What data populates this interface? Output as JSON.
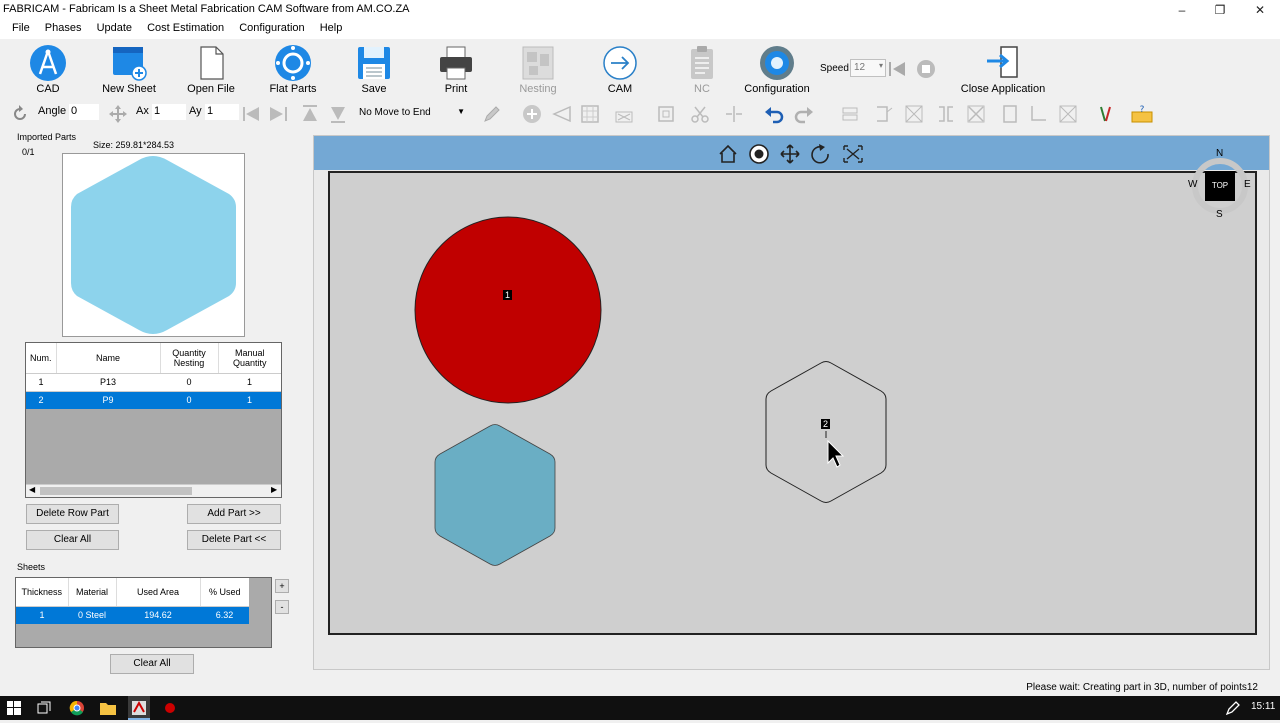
{
  "window": {
    "title": "FABRICAM - Fabricam Is a Sheet Metal Fabrication CAM Software from AM.CO.ZA"
  },
  "menu": [
    "File",
    "Phases",
    "Update",
    "Cost Estimation",
    "Configuration",
    "Help"
  ],
  "toolbar": {
    "cad": "CAD",
    "new_sheet": "New Sheet",
    "open_file": "Open File",
    "flat_parts": "Flat Parts",
    "save": "Save",
    "print": "Print",
    "nesting": "Nesting",
    "cam": "CAM",
    "nc": "NC",
    "configuration": "Configuration",
    "close_application": "Close Application",
    "speed_label": "Speed",
    "speed_value": "12"
  },
  "toolbar2": {
    "angle_label": "Angle",
    "angle_value": "0",
    "ax_label": "Ax",
    "ax_value": "1",
    "ay_label": "Ay",
    "ay_value": "1",
    "move_select": "No Move to End"
  },
  "imported": {
    "title": "Imported Parts",
    "count": "0/1",
    "size": "Size: 259.81*284.53"
  },
  "parts_table": {
    "headers": [
      "Num.",
      "Name",
      "Quantity Nesting",
      "Manual Quantity"
    ],
    "rows": [
      [
        "1",
        "P13",
        "0",
        "1"
      ],
      [
        "2",
        "P9",
        "0",
        "1"
      ]
    ],
    "selected": 1
  },
  "buttons": {
    "delete_row": "Delete Row Part",
    "add_part": "Add Part >>",
    "clear_all": "Clear All",
    "delete_part": "Delete Part <<",
    "clear_all2": "Clear All",
    "plus": "+",
    "minus": "-"
  },
  "sheets": {
    "title": "Sheets",
    "headers": [
      "Thickness",
      "Material",
      "Used Area",
      "% Used"
    ],
    "rows": [
      [
        "1",
        "0  Steel",
        "194.62",
        "6.32"
      ]
    ]
  },
  "view": {
    "compass": {
      "n": "N",
      "s": "S",
      "e": "E",
      "w": "W",
      "top": "TOP"
    },
    "part1_label": "1",
    "part2_label": "2"
  },
  "status": "Please wait: Creating part in 3D, number of points12",
  "clock": "15:11",
  "colors": {
    "accent": "#0078d7",
    "part_red": "#c00000",
    "part_blue": "#8dd3ec",
    "part_blue_dark": "#6aaec4",
    "sheet": "#cfcfcf",
    "view_header": "#74a8d4"
  }
}
